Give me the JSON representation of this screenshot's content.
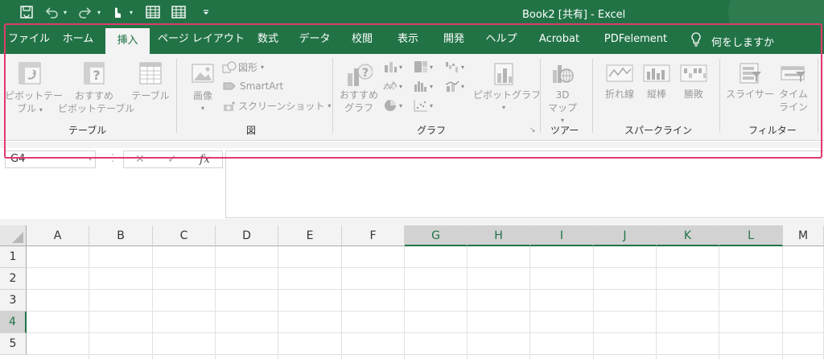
{
  "title": {
    "text": "Book2 [共有] - Excel"
  },
  "quick_access": {
    "icons": [
      "save-autorecover-icon",
      "undo-icon",
      "redo-icon",
      "touch-mode-icon",
      "table-icon",
      "table-icon-2",
      "customize-qat-icon"
    ]
  },
  "tabs": [
    {
      "label": "ファイル"
    },
    {
      "label": "ホーム"
    },
    {
      "label": "挿入",
      "active": true
    },
    {
      "label": "ページ レイアウト"
    },
    {
      "label": "数式"
    },
    {
      "label": "データ"
    },
    {
      "label": "校閲"
    },
    {
      "label": "表示"
    },
    {
      "label": "開発"
    },
    {
      "label": "ヘルプ"
    },
    {
      "label": "Acrobat"
    },
    {
      "label": "PDFelement"
    }
  ],
  "tell_me": {
    "label": "何をしますか"
  },
  "ribbon": {
    "tables": {
      "label": "テーブル",
      "pivot_table": {
        "line1": "ピボットテー",
        "line2": "ブル"
      },
      "recommended_pivot": {
        "line1": "おすすめ",
        "line2": "ピボットテーブル"
      },
      "table": {
        "label": "テーブル"
      }
    },
    "illustrations": {
      "label": "図",
      "picture": {
        "label": "画像"
      },
      "shapes": {
        "label": "図形"
      },
      "smartart": {
        "label": "SmartArt"
      },
      "screenshot": {
        "label": "スクリーンショット"
      }
    },
    "charts": {
      "label": "グラフ",
      "recommended": {
        "line1": "おすすめ",
        "line2": "グラフ"
      },
      "pivot_chart": {
        "label": "ピボットグラフ"
      }
    },
    "tours": {
      "label": "ツアー",
      "map3d": {
        "line1": "3D",
        "line2": "マップ"
      }
    },
    "sparklines": {
      "label": "スパークライン",
      "line": {
        "label": "折れ線"
      },
      "column": {
        "label": "縦棒"
      },
      "winloss": {
        "label": "勝敗"
      }
    },
    "filters": {
      "label": "フィルター",
      "slicer": {
        "label": "スライサー"
      },
      "timeline": {
        "line1": "タイム",
        "line2": "ライン"
      }
    }
  },
  "formula_bar": {
    "name_box": "G4",
    "cancel": "✕",
    "enter": "✓",
    "fx": "fx",
    "value": ""
  },
  "grid": {
    "columns": [
      "A",
      "B",
      "C",
      "D",
      "E",
      "F",
      "G",
      "H",
      "I",
      "J",
      "K",
      "L",
      "M"
    ],
    "selected_columns": [
      "G",
      "H",
      "I",
      "J",
      "K",
      "L"
    ],
    "rows": [
      "1",
      "2",
      "3",
      "4",
      "5"
    ],
    "selected_rows": [
      "4"
    ]
  },
  "colors": {
    "brand": "#217346",
    "highlight": "#e23a6e",
    "ribbon_bg": "#f3f3f3",
    "disabled_text": "#9a9a9a"
  }
}
